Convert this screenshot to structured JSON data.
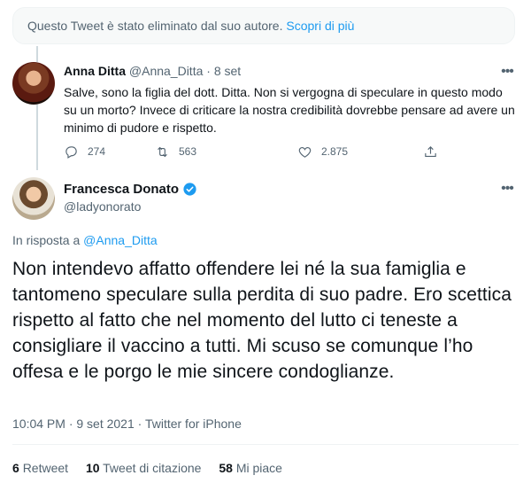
{
  "deleted_notice": {
    "text": "Questo Tweet è stato eliminato dal suo autore.",
    "link": "Scopri di più"
  },
  "tweet1": {
    "name": "Anna Ditta",
    "handle": "@Anna_Ditta",
    "separator": "·",
    "date": "8 set",
    "text": "Salve, sono la figlia del dott. Ditta. Non si vergogna di speculare in questo modo su un morto? Invece di criticare la nostra credibilità dovrebbe pensare ad avere un minimo di pudore e rispetto.",
    "replies": "274",
    "retweets": "563",
    "likes": "2.875"
  },
  "tweet2": {
    "name": "Francesca Donato",
    "handle": "@ladyonorato",
    "reply_prefix": "In risposta a",
    "reply_to": "@Anna_Ditta",
    "text": "Non intendevo affatto offendere lei né la sua famiglia e tantomeno speculare sulla perdita di suo padre. Ero scettica rispetto al fatto che nel momento del lutto ci teneste a consigliare il vaccino a tutti. Mi scuso se comunque l’ho offesa e le porgo le mie sincere condoglianze.",
    "meta": "10:04 PM · 9 set 2021 · Twitter for iPhone",
    "stats": {
      "retweets_count": "6",
      "retweets_label": "Retweet",
      "quotes_count": "10",
      "quotes_label": "Tweet di citazione",
      "likes_count": "58",
      "likes_label": "Mi piace"
    }
  },
  "colors": {
    "accent": "#1d9bf0",
    "muted": "#536471",
    "text": "#0f1419"
  }
}
